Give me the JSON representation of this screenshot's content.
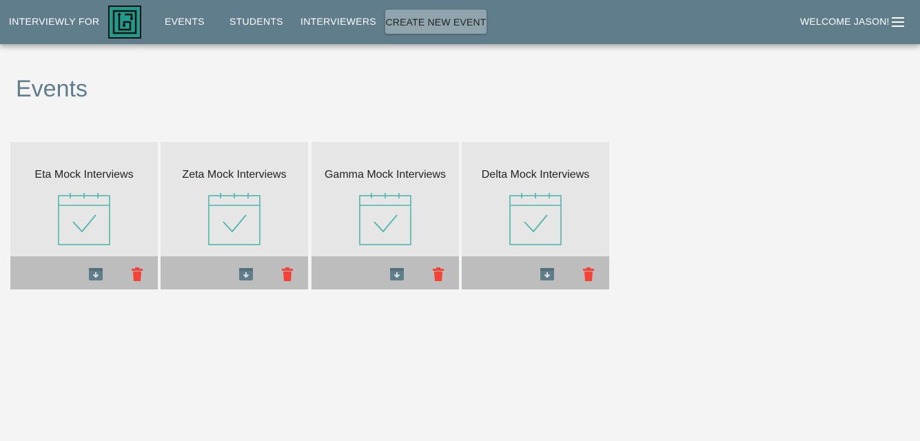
{
  "header": {
    "brand": "INTERVIEWLY FOR",
    "logo_icon": "circuit-logo-icon",
    "nav": [
      "EVENTS",
      "STUDENTS",
      "INTERVIEWERS"
    ],
    "create_button": "CREATE NEW EVENT",
    "welcome": "WELCOME JASON!",
    "menu_icon": "hamburger-menu-icon"
  },
  "main": {
    "title": "Events",
    "events": [
      {
        "name": "Eta Mock Interviews"
      },
      {
        "name": "Zeta Mock Interviews"
      },
      {
        "name": "Gamma Mock Interviews"
      },
      {
        "name": "Delta Mock Interviews"
      }
    ],
    "icons": {
      "event": "calendar-check-icon",
      "archive": "archive-icon",
      "delete": "trash-icon"
    }
  },
  "colors": {
    "header": "#607d8b",
    "accent": "#4db6ac",
    "delete": "#f44336",
    "archive": "#607d8b"
  }
}
